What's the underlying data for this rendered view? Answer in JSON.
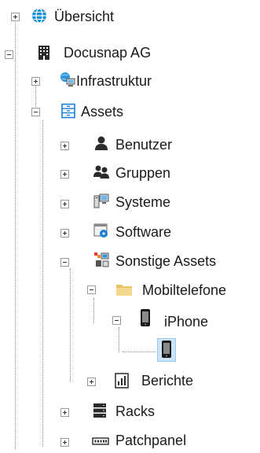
{
  "tree": {
    "overview": {
      "label": "Übersicht",
      "icon": "globe-icon"
    },
    "company": {
      "label": "Docusnap AG",
      "icon": "building-icon"
    },
    "infrastructure": {
      "label": "Infrastruktur",
      "icon": "network-icon"
    },
    "assets": {
      "label": "Assets",
      "icon": "assets-icon"
    },
    "users": {
      "label": "Benutzer",
      "icon": "user-icon"
    },
    "groups": {
      "label": "Gruppen",
      "icon": "group-icon"
    },
    "systems": {
      "label": "Systeme",
      "icon": "computer-icon"
    },
    "software": {
      "label": "Software",
      "icon": "software-icon"
    },
    "other_assets": {
      "label": "Sonstige Assets",
      "icon": "other-assets-icon"
    },
    "mobile_phones": {
      "label": "Mobiltelefone",
      "icon": "folder-icon"
    },
    "iphone": {
      "label": "iPhone",
      "icon": "phone-icon"
    },
    "iphone_item": {
      "label": "",
      "icon": "phone-icon"
    },
    "reports": {
      "label": "Berichte",
      "icon": "report-icon"
    },
    "racks": {
      "label": "Racks",
      "icon": "rack-icon"
    },
    "patchpanel": {
      "label": "Patchpanel",
      "icon": "patchpanel-icon"
    }
  },
  "colors": {
    "selection": "#cce4f7",
    "globe": "#1a8fd6",
    "assets": "#1a7fd4",
    "folder": "#e8c36a"
  }
}
